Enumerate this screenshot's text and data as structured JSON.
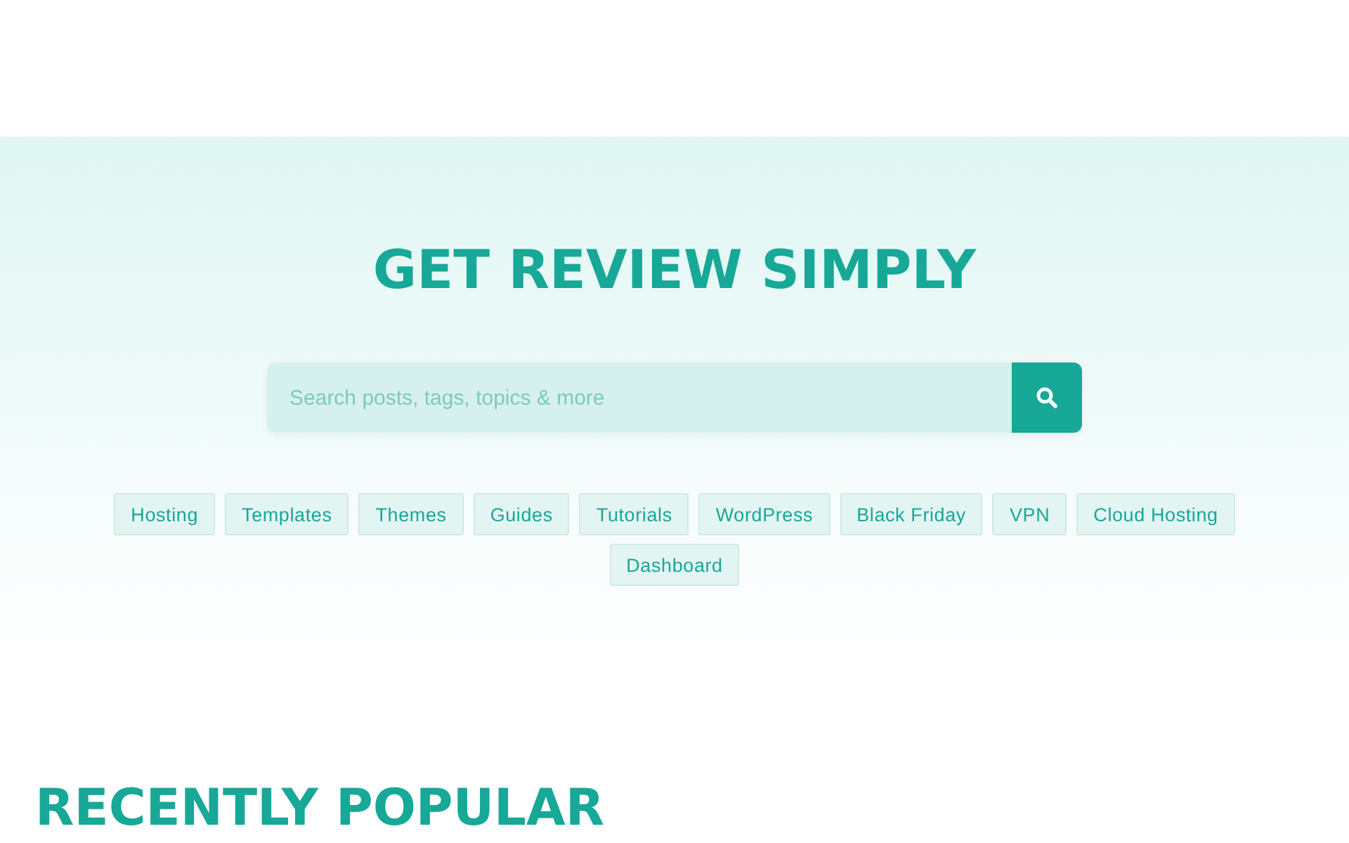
{
  "hero": {
    "title": "GET REVIEW SIMPLY",
    "search": {
      "placeholder": "Search posts, tags, topics & more"
    },
    "tags": [
      "Hosting",
      "Templates",
      "Themes",
      "Guides",
      "Tutorials",
      "WordPress",
      "Black Friday",
      "VPN",
      "Cloud Hosting",
      "Dashboard"
    ]
  },
  "section": {
    "heading": "RECENTLY POPULAR"
  }
}
